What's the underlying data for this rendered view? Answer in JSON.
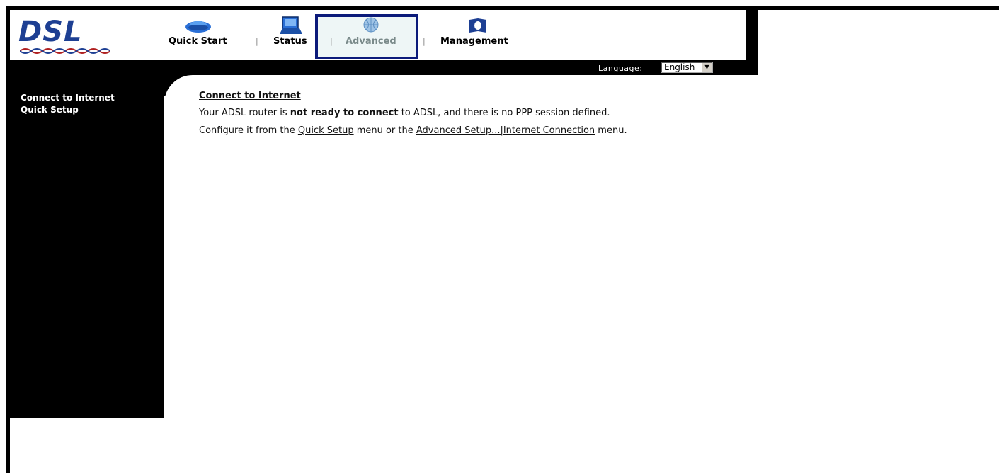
{
  "logo": {
    "text": "DSL"
  },
  "nav": {
    "items": [
      {
        "label": "Quick Start",
        "icon": "car-icon"
      },
      {
        "label": "Status",
        "icon": "laptop-icon"
      },
      {
        "label": "Advanced",
        "icon": "globe-icon",
        "active": true
      },
      {
        "label": "Management",
        "icon": "book-icon"
      }
    ],
    "separator": "|"
  },
  "language": {
    "label": "Language:",
    "selected": "English",
    "arrow": "▼"
  },
  "sidebar": {
    "items": [
      {
        "label": "Connect to Internet"
      },
      {
        "label": "Quick Setup"
      }
    ]
  },
  "main": {
    "title": "Connect to Internet",
    "line1": {
      "prefix": "Your ADSL router is ",
      "bold": "not ready to connect",
      "suffix": " to ADSL, and there is no PPP session defined."
    },
    "line2": {
      "prefix": "Configure it from the ",
      "link1": "Quick Setup",
      "middle": " menu or the ",
      "link2": "Advanced Setup...|Internet Connection",
      "suffix": " menu."
    }
  },
  "colors": {
    "brand": "#1d3f93",
    "active_border": "#0b1a7a"
  }
}
